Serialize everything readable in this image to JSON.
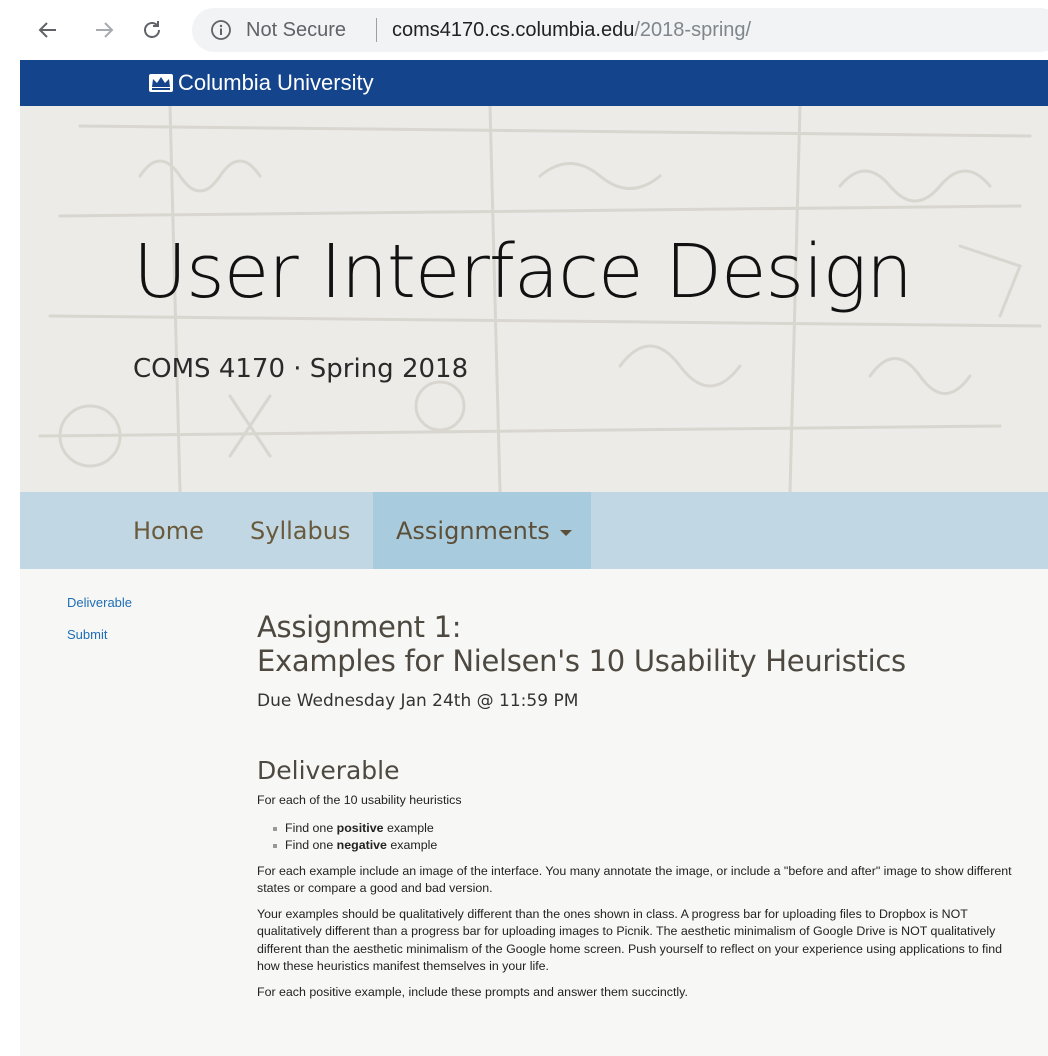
{
  "browser": {
    "security_label": "Not Secure",
    "url_host": "coms4170.cs.columbia.edu",
    "url_path": "/2018-spring/"
  },
  "header": {
    "university": "Columbia University",
    "brand_color": "#14448b"
  },
  "hero": {
    "title": "User Interface Design",
    "subtitle": "COMS 4170 · Spring 2018"
  },
  "nav": {
    "items": [
      {
        "label": "Home"
      },
      {
        "label": "Syllabus"
      },
      {
        "label": "Assignments",
        "active": true,
        "has_dropdown": true
      }
    ],
    "bar_color": "#c1d7e3",
    "active_color": "#a9cbde"
  },
  "sidebar": {
    "links": [
      {
        "label": "Deliverable"
      },
      {
        "label": "Submit"
      }
    ]
  },
  "main": {
    "title_line1": "Assignment 1:",
    "title_line2": "Examples for Nielsen's 10 Usability Heuristics",
    "due": "Due Wednesday Jan 24th @ 11:59 PM",
    "deliverable": {
      "heading": "Deliverable",
      "intro": "For each of the 10 usability heuristics",
      "bullets": [
        {
          "prefix": "Find one ",
          "bold": "positive",
          "suffix": " example"
        },
        {
          "prefix": "Find one ",
          "bold": "negative",
          "suffix": " example"
        }
      ],
      "paragraphs": [
        "For each example include an image of the interface. You many annotate the image, or include a \"before and after\" image to show different states or compare a good and bad version.",
        "Your examples should be qualitatively different than the ones shown in class. A progress bar for uploading files to Dropbox is NOT qualitatively different than a progress bar for uploading images to Picnik. The aesthetic minimalism of Google Drive is NOT qualitatively different than the aesthetic minimalism of the Google home screen. Push yourself to reflect on your experience using applications to find how these heuristics manifest themselves in your life.",
        "For each positive example, include these prompts and answer them succinctly."
      ]
    }
  }
}
